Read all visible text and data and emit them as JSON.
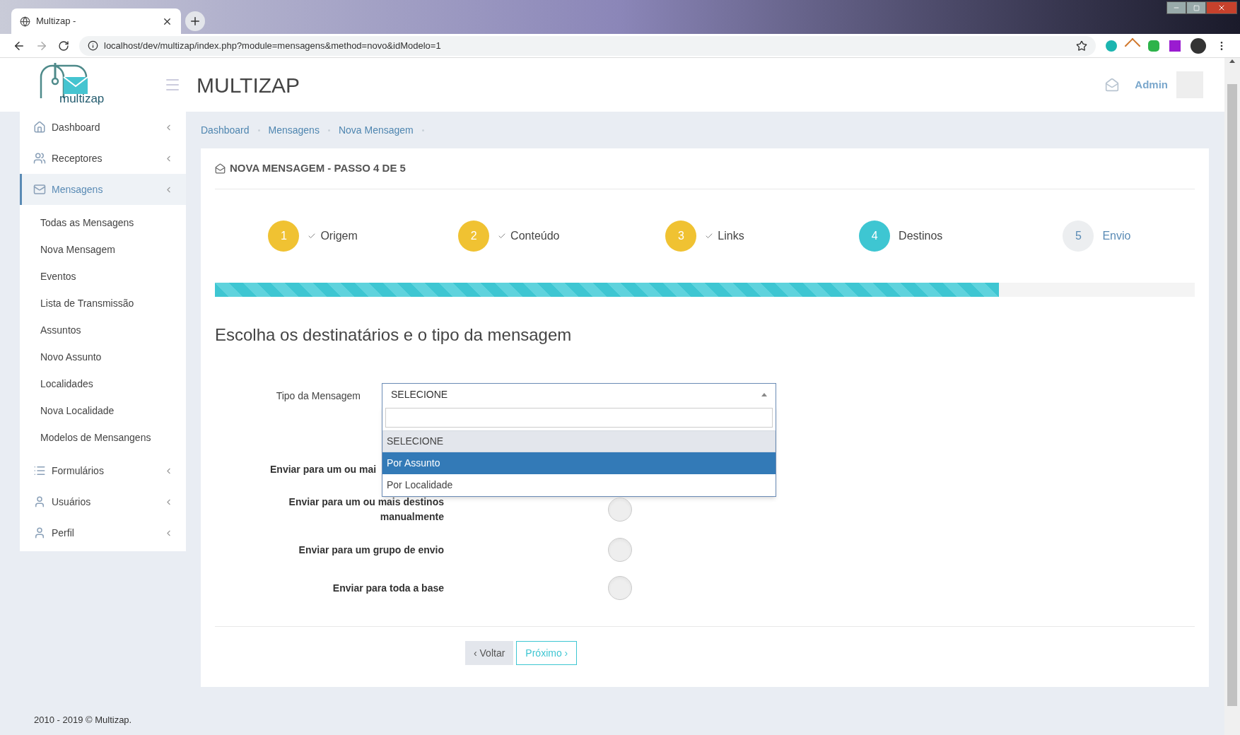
{
  "browser": {
    "tab_title": "Multizap -",
    "url": "localhost/dev/multizap/index.php?module=mensagens&method=novo&idModelo=1"
  },
  "header": {
    "brand": "MULTIZAP",
    "logo_text": "multizap",
    "user": "Admin"
  },
  "sidebar": {
    "items": [
      {
        "label": "Dashboard",
        "active": false
      },
      {
        "label": "Receptores",
        "active": false
      },
      {
        "label": "Mensagens",
        "active": true,
        "children": [
          {
            "label": "Todas as Mensagens"
          },
          {
            "label": "Nova Mensagem"
          },
          {
            "label": "Eventos"
          },
          {
            "label": "Lista de Transmissão"
          },
          {
            "label": "Assuntos"
          },
          {
            "label": "Novo Assunto"
          },
          {
            "label": "Localidades"
          },
          {
            "label": "Nova Localidade"
          },
          {
            "label": "Modelos de Mensangens"
          }
        ]
      },
      {
        "label": "Formulários",
        "active": false
      },
      {
        "label": "Usuários",
        "active": false
      },
      {
        "label": "Perfil",
        "active": false
      }
    ]
  },
  "breadcrumb": [
    "Dashboard",
    "Mensagens",
    "Nova Mensagem"
  ],
  "card": {
    "title": "NOVA MENSAGEM - PASSO 4 DE 5",
    "steps": [
      {
        "number": "1",
        "label": "Origem",
        "done": true,
        "active": false
      },
      {
        "number": "2",
        "label": "Conteúdo",
        "done": true,
        "active": false
      },
      {
        "number": "3",
        "label": "Links",
        "done": true,
        "active": false
      },
      {
        "number": "4",
        "label": "Destinos",
        "done": false,
        "active": true
      },
      {
        "number": "5",
        "label": "Envio",
        "done": false,
        "active": false
      }
    ],
    "progress": {
      "level": 0.8
    },
    "heading": "Escolha os destinatários e o tipo da mensagem",
    "type_field": {
      "label": "Tipo da Mensagem",
      "value": "SELECIONE",
      "expanded": true,
      "options": [
        {
          "label": "SELECIONE",
          "selected": true,
          "highlighted": false
        },
        {
          "label": "Por Assunto",
          "selected": false,
          "highlighted": true
        },
        {
          "label": "Por Localidade",
          "selected": false,
          "highlighted": false
        }
      ]
    },
    "destinations": [
      {
        "label": "Enviar para um ou mai"
      },
      {
        "label": "Enviar para um ou mais destinos manualmente",
        "on": false
      },
      {
        "label": "Enviar para um grupo de envio",
        "on": false
      },
      {
        "label": "Enviar para toda a base",
        "on": false
      }
    ],
    "buttons": [
      {
        "label": "‹ Voltar",
        "kind": "secondary"
      },
      {
        "label": "Próximo ›",
        "kind": "primary"
      }
    ]
  },
  "footer": "2010 - 2019 © Multizap."
}
